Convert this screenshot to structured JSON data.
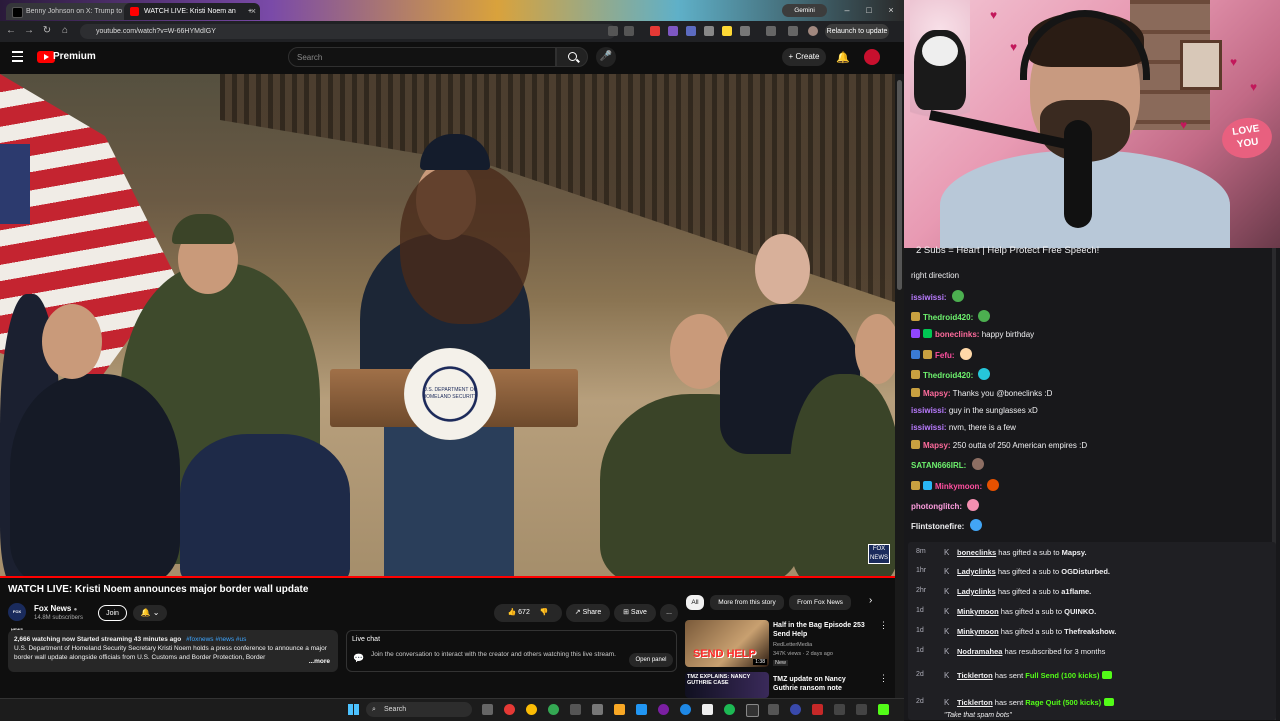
{
  "browser": {
    "tabs": [
      {
        "label": "Benny Johnson on X: Trump to",
        "active": false
      },
      {
        "label": "WATCH LIVE: Kristi Noem an",
        "active": true
      }
    ],
    "gemini_label": "Gemini",
    "url": "youtube.com/watch?v=W-66HYMdIGY",
    "relaunch_label": "Relaunch to update"
  },
  "youtube": {
    "logo_text": "Premium",
    "search_placeholder": "Search",
    "create_label": "+ Create",
    "video_overlay": {
      "seal_text": "U.S. DEPARTMENT OF HOMELAND SECURITY",
      "fox_bug": "FOX NEWS"
    },
    "video_title": "WATCH LIVE: Kristi Noem announces major border wall update",
    "channel": {
      "name": "Fox News",
      "avatar_text": "FOX NEWS",
      "subscribers": "14.8M subscribers",
      "join_label": "Join"
    },
    "actions": {
      "like_count": "672",
      "share_label": "Share",
      "save_label": "Save",
      "more_label": "..."
    },
    "description": {
      "stats": "2,666 watching now  Started streaming 43 minutes ago",
      "tags": "#foxnews #news #us",
      "text": "U.S. Department of Homeland Security Secretary Kristi Noem holds a press conference to announce a major border wall update alongside officials from U.S. Customs and Border Protection, Border",
      "more": "...more"
    },
    "live_chat": {
      "title": "Live chat",
      "text": "Join the conversation to interact with the creator and others watching this live stream.",
      "open_label": "Open panel"
    },
    "chips": [
      "All",
      "More from this story",
      "From Fox News"
    ],
    "recommendations": [
      {
        "title": "Half in the Bag Episode 253 Send Help",
        "channel": "RedLetterMedia",
        "meta": "347K views · 2 days ago",
        "badge": "New",
        "thumb_text": "SEND HELP",
        "duration": "1:38"
      },
      {
        "title": "TMZ update on Nancy Guthrie ransom note",
        "channel": "",
        "meta": "",
        "badge": "",
        "thumb_text": "TMZ EXPLAINS: NANCY GUTHRIE CASE",
        "duration": ""
      }
    ],
    "progress_fraction": 1.0
  },
  "taskbar": {
    "search_label": "Search"
  },
  "stream": {
    "love_sign": "LOVE YOU",
    "banner": "2 Subs = Heart | Help Protect Free Speech!"
  },
  "chat": {
    "messages": [
      {
        "user": "",
        "text": "right direction",
        "color": "#efeff1"
      },
      {
        "user": "issiwissi:",
        "text": "",
        "color": "#b97bff",
        "emote": "#4caf50"
      },
      {
        "user": "Thedroid420:",
        "text": "",
        "color": "#6ef26e",
        "emote": "#4caf50",
        "badge": "#c8a040"
      },
      {
        "user": "boneclinks:",
        "text": "happy birthday",
        "color": "#ff6b9d",
        "badge": "#9146ff",
        "badge2": "#00c853"
      },
      {
        "user": "Fefu:",
        "text": "",
        "color": "#ff4fa0",
        "emote": "#ffd8a8",
        "badge": "#3a7bd5",
        "badge2": "#c8a040"
      },
      {
        "user": "Thedroid420:",
        "text": "",
        "color": "#6ef26e",
        "emote": "#26c6da",
        "badge": "#c8a040"
      },
      {
        "user": "Mapsy:",
        "text": "Thanks you @boneclinks :D",
        "color": "#ff6b9d",
        "badge": "#c8a040"
      },
      {
        "user": "issiwissi:",
        "text": "guy in the sunglasses xD",
        "color": "#b97bff"
      },
      {
        "user": "issiwissi:",
        "text": "nvm, there is a few",
        "color": "#b97bff"
      },
      {
        "user": "Mapsy:",
        "text": "250 outta of 250 American empires :D",
        "color": "#ff6b9d",
        "badge": "#c8a040"
      },
      {
        "user": "SATAN666IRL:",
        "text": "",
        "color": "#6ef26e",
        "emote": "#8d6e63"
      },
      {
        "user": "Minkymoon:",
        "text": "",
        "color": "#ff4fa0",
        "emote": "#e65100",
        "badge": "#c8a040",
        "badge2": "#29b6f6"
      },
      {
        "user": "photonglitch:",
        "text": "",
        "color": "#ff9ee0",
        "emote": "#f48fb1"
      },
      {
        "user": "Flintstonefire:",
        "text": "",
        "color": "#efeff1",
        "emote": "#42a5f5"
      }
    ],
    "notifications": [
      {
        "time": "8m",
        "name": "boneclinks",
        "text": " has gifted a sub to ",
        "target": "Mapsy."
      },
      {
        "time": "1hr",
        "name": "Ladyclinks",
        "text": " has gifted a sub to ",
        "target": "OGDisturbed."
      },
      {
        "time": "2hr",
        "name": "Ladyclinks",
        "text": " has gifted a sub to ",
        "target": "a1flame."
      },
      {
        "time": "1d",
        "name": "Minkymoon",
        "text": " has gifted a sub to ",
        "target": "QUINKO."
      },
      {
        "time": "1d",
        "name": "Minkymoon",
        "text": " has gifted a sub to ",
        "target": "Thefreakshow."
      },
      {
        "time": "1d",
        "name": "Nodramahea",
        "text": " has resubscribed for 3 months",
        "target": ""
      },
      {
        "time": "2d",
        "name": "Ticklerton",
        "text": " has sent ",
        "target": "Full Send (100 kicks)"
      },
      {
        "time": "2d",
        "name": "Ticklerton",
        "text": " has sent ",
        "target": "Rage Quit (500 kicks)"
      }
    ],
    "spam_note": "\"Take that spam bots\""
  }
}
